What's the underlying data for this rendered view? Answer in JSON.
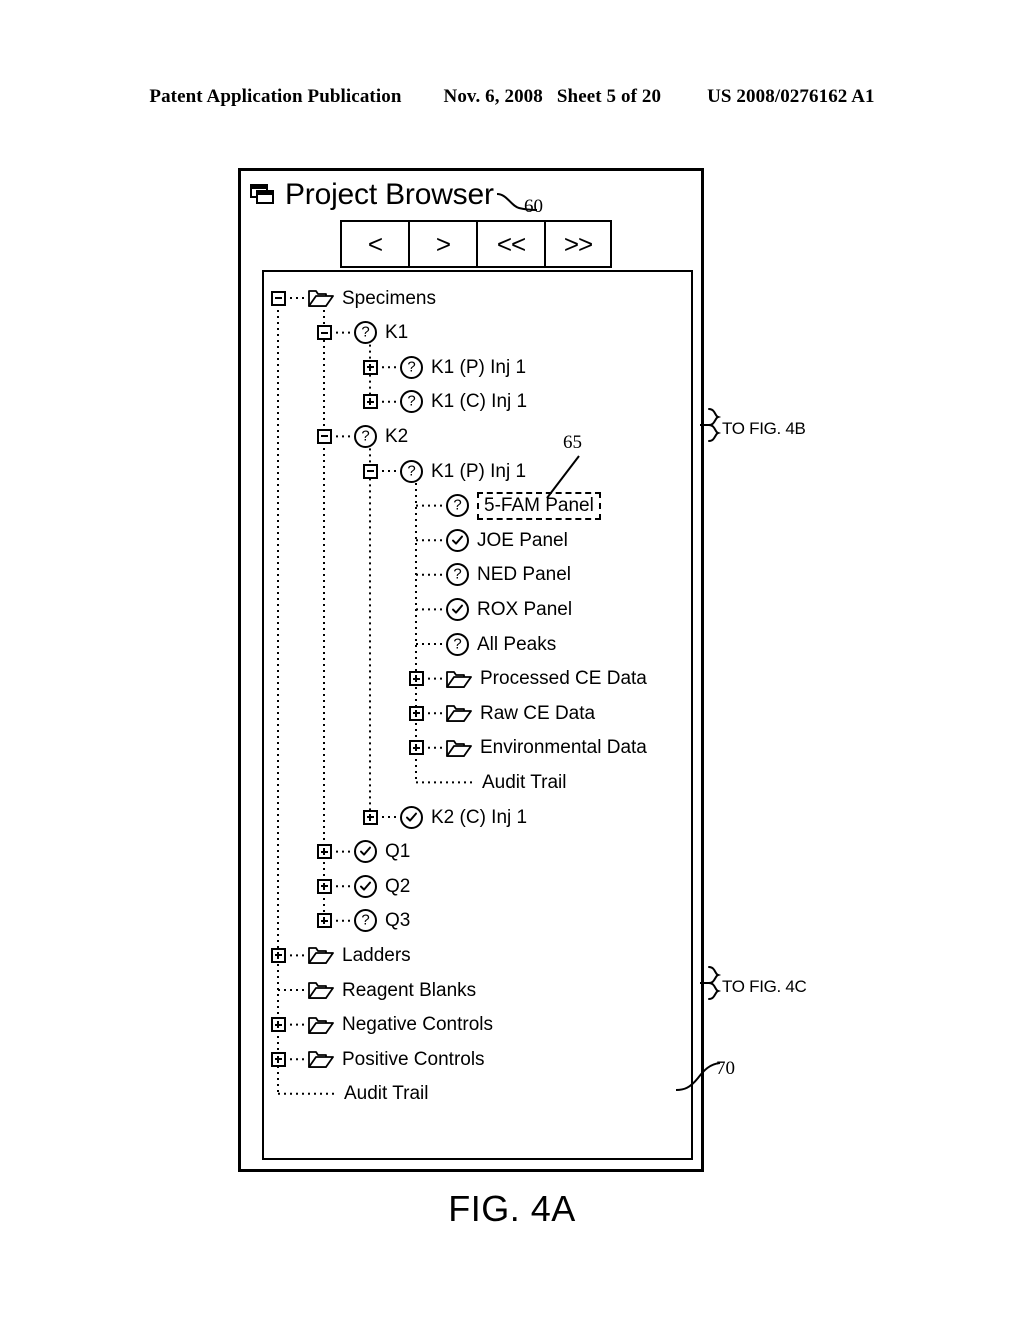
{
  "publication_header": {
    "title": "Patent Application Publication",
    "date": "Nov. 6, 2008",
    "sheet": "Sheet 5 of 20",
    "patent_number": "US 2008/0276162 A1"
  },
  "figure": {
    "caption": "FIG. 4A",
    "reference_numerals": {
      "title_bar": "60",
      "selected_node": "65",
      "window_frame": "70"
    },
    "callouts": [
      {
        "id": "to-fig-4b",
        "text": "TO FIG. 4B"
      },
      {
        "id": "to-fig-4c",
        "text": "TO FIG. 4C"
      }
    ]
  },
  "window": {
    "title": "Project Browser",
    "title_icon": "cascading-windows-icon",
    "nav_buttons": [
      {
        "id": "prev",
        "label": "<"
      },
      {
        "id": "next",
        "label": ">"
      },
      {
        "id": "first",
        "label": "<<"
      },
      {
        "id": "last",
        "label": ">>"
      }
    ]
  },
  "tree": {
    "nodes": [
      {
        "id": "specimens",
        "label": "Specimens",
        "depth": 0,
        "icon": "folder",
        "expander": "minus",
        "selected": false
      },
      {
        "id": "k1",
        "label": "K1",
        "depth": 1,
        "icon": "question",
        "expander": "minus",
        "selected": false
      },
      {
        "id": "k1-p-inj1",
        "label": "K1 (P) Inj 1",
        "depth": 2,
        "icon": "question",
        "expander": "plus",
        "selected": false
      },
      {
        "id": "k1-c-inj1",
        "label": "K1 (C) Inj 1",
        "depth": 2,
        "icon": "question",
        "expander": "plus",
        "selected": false
      },
      {
        "id": "k2",
        "label": "K2",
        "depth": 1,
        "icon": "question",
        "expander": "minus",
        "selected": false
      },
      {
        "id": "k2-k1-p-inj1",
        "label": "K1 (P) Inj 1",
        "depth": 2,
        "icon": "question",
        "expander": "minus",
        "selected": false
      },
      {
        "id": "panel-5fam",
        "label": "5-FAM Panel",
        "depth": 3,
        "icon": "question",
        "expander": "none",
        "selected": true
      },
      {
        "id": "panel-joe",
        "label": "JOE Panel",
        "depth": 3,
        "icon": "check",
        "expander": "none",
        "selected": false
      },
      {
        "id": "panel-ned",
        "label": "NED Panel",
        "depth": 3,
        "icon": "question",
        "expander": "none",
        "selected": false
      },
      {
        "id": "panel-rox",
        "label": "ROX Panel",
        "depth": 3,
        "icon": "check",
        "expander": "none",
        "selected": false
      },
      {
        "id": "all-peaks",
        "label": "All Peaks",
        "depth": 3,
        "icon": "question",
        "expander": "none",
        "selected": false
      },
      {
        "id": "processed-ce",
        "label": "Processed CE Data",
        "depth": 3,
        "icon": "folder",
        "expander": "plus",
        "selected": false
      },
      {
        "id": "raw-ce",
        "label": "Raw CE Data",
        "depth": 3,
        "icon": "folder",
        "expander": "plus",
        "selected": false
      },
      {
        "id": "environmental",
        "label": "Environmental Data",
        "depth": 3,
        "icon": "folder",
        "expander": "plus",
        "selected": false
      },
      {
        "id": "audit-trail-inner",
        "label": "Audit Trail",
        "depth": 3,
        "icon": "none",
        "expander": "none",
        "selected": false
      },
      {
        "id": "k2-c-inj1",
        "label": "K2 (C) Inj 1",
        "depth": 2,
        "icon": "check",
        "expander": "plus",
        "selected": false
      },
      {
        "id": "q1",
        "label": "Q1",
        "depth": 1,
        "icon": "check",
        "expander": "plus",
        "selected": false
      },
      {
        "id": "q2",
        "label": "Q2",
        "depth": 1,
        "icon": "check",
        "expander": "plus",
        "selected": false
      },
      {
        "id": "q3",
        "label": "Q3",
        "depth": 1,
        "icon": "question",
        "expander": "plus",
        "selected": false
      },
      {
        "id": "ladders",
        "label": "Ladders",
        "depth": 0,
        "icon": "folder",
        "expander": "plus",
        "selected": false
      },
      {
        "id": "reagent-blanks",
        "label": "Reagent Blanks",
        "depth": 0,
        "icon": "folder",
        "expander": "none",
        "selected": false
      },
      {
        "id": "negative-controls",
        "label": "Negative Controls",
        "depth": 0,
        "icon": "folder",
        "expander": "plus",
        "selected": false
      },
      {
        "id": "positive-controls",
        "label": "Positive Controls",
        "depth": 0,
        "icon": "folder",
        "expander": "plus",
        "selected": false
      },
      {
        "id": "audit-trail-root",
        "label": "Audit Trail",
        "depth": 0,
        "icon": "none",
        "expander": "none",
        "selected": false
      }
    ]
  },
  "colors": {
    "ink": "#000000",
    "paper": "#ffffff"
  }
}
